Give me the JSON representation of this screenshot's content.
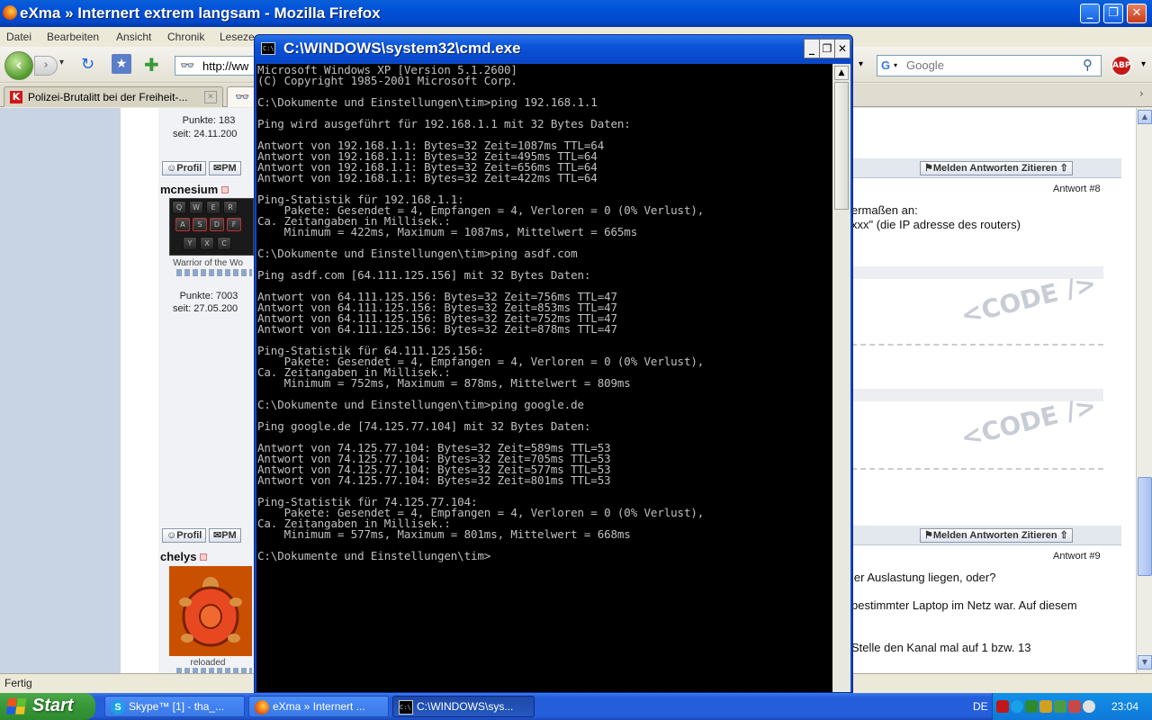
{
  "firefox": {
    "title": "eXma » Internert extrem langsam - Mozilla Firefox",
    "menu": [
      "Datei",
      "Bearbeiten",
      "Ansicht",
      "Chronik",
      "Leseze"
    ],
    "url": "http://ww",
    "search_placeholder": "Google",
    "abp_label": "ABP",
    "tabs": [
      {
        "label": "Polizei-Brutalitt bei der Freiheit-..."
      },
      {
        "label": ""
      }
    ],
    "status": "Fertig"
  },
  "forum": {
    "post1": {
      "points": "Punkte: 183",
      "since": "seit: 24.11.200",
      "profile_btn": "Profil",
      "pm_btn": "PM",
      "actions": "Melden  Antworten  Zitieren",
      "answer_num": "Antwort #8",
      "text_lines": [
        "ermaßen an:",
        "xxx\" (die IP adresse des routers)"
      ],
      "code_label": "<CODE />"
    },
    "user2": {
      "name": "mcnesium",
      "rank": "Warrior of the Wo",
      "points": "Punkte: 7003",
      "since": "seit: 27.05.200",
      "profile_btn": "Profil",
      "pm_btn": "PM",
      "keys": [
        "Q",
        "W",
        "E",
        "R",
        "A",
        "S",
        "D",
        "F",
        "Y",
        "X",
        "C"
      ]
    },
    "post2": {
      "actions": "Melden  Antworten  Zitieren",
      "answer_num": "Antwort #9",
      "text_lines": [
        "ler Auslastung liegen, oder?",
        "bestimmter Laptop im Netz war. Auf diesem",
        "Stelle den Kanal mal auf 1 bzw. 13"
      ]
    },
    "user3": {
      "name": "chelys",
      "rank": "reloaded"
    }
  },
  "cmd": {
    "title": "C:\\WINDOWS\\system32\\cmd.exe",
    "lines": [
      "Microsoft Windows XP [Version 5.1.2600]",
      "(C) Copyright 1985-2001 Microsoft Corp.",
      "",
      "C:\\Dokumente und Einstellungen\\tim>ping 192.168.1.1",
      "",
      "Ping wird ausgeführt für 192.168.1.1 mit 32 Bytes Daten:",
      "",
      "Antwort von 192.168.1.1: Bytes=32 Zeit=1087ms TTL=64",
      "Antwort von 192.168.1.1: Bytes=32 Zeit=495ms TTL=64",
      "Antwort von 192.168.1.1: Bytes=32 Zeit=656ms TTL=64",
      "Antwort von 192.168.1.1: Bytes=32 Zeit=422ms TTL=64",
      "",
      "Ping-Statistik für 192.168.1.1:",
      "    Pakete: Gesendet = 4, Empfangen = 4, Verloren = 0 (0% Verlust),",
      "Ca. Zeitangaben in Millisek.:",
      "    Minimum = 422ms, Maximum = 1087ms, Mittelwert = 665ms",
      "",
      "C:\\Dokumente und Einstellungen\\tim>ping asdf.com",
      "",
      "Ping asdf.com [64.111.125.156] mit 32 Bytes Daten:",
      "",
      "Antwort von 64.111.125.156: Bytes=32 Zeit=756ms TTL=47",
      "Antwort von 64.111.125.156: Bytes=32 Zeit=853ms TTL=47",
      "Antwort von 64.111.125.156: Bytes=32 Zeit=752ms TTL=47",
      "Antwort von 64.111.125.156: Bytes=32 Zeit=878ms TTL=47",
      "",
      "Ping-Statistik für 64.111.125.156:",
      "    Pakete: Gesendet = 4, Empfangen = 4, Verloren = 0 (0% Verlust),",
      "Ca. Zeitangaben in Millisek.:",
      "    Minimum = 752ms, Maximum = 878ms, Mittelwert = 809ms",
      "",
      "C:\\Dokumente und Einstellungen\\tim>ping google.de",
      "",
      "Ping google.de [74.125.77.104] mit 32 Bytes Daten:",
      "",
      "Antwort von 74.125.77.104: Bytes=32 Zeit=589ms TTL=53",
      "Antwort von 74.125.77.104: Bytes=32 Zeit=705ms TTL=53",
      "Antwort von 74.125.77.104: Bytes=32 Zeit=577ms TTL=53",
      "Antwort von 74.125.77.104: Bytes=32 Zeit=801ms TTL=53",
      "",
      "Ping-Statistik für 74.125.77.104:",
      "    Pakete: Gesendet = 4, Empfangen = 4, Verloren = 0 (0% Verlust),",
      "Ca. Zeitangaben in Millisek.:",
      "    Minimum = 577ms, Maximum = 801ms, Mittelwert = 668ms",
      "",
      "C:\\Dokumente und Einstellungen\\tim>"
    ]
  },
  "taskbar": {
    "start_label": "Start",
    "buttons": [
      {
        "label": "Skype™ [1] - tha_...",
        "icon": "skype-icon"
      },
      {
        "label": "eXma » Internert ...",
        "icon": "firefox-icon"
      },
      {
        "label": "C:\\WINDOWS\\sys...",
        "icon": "cmd-icon"
      }
    ],
    "language": "DE",
    "clock": "23:04"
  }
}
